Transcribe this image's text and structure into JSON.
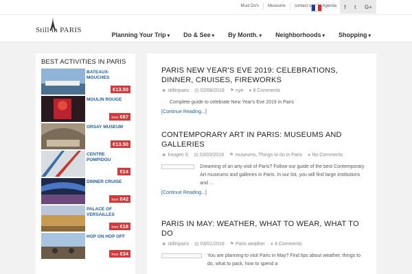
{
  "topbar": {
    "links": [
      "Must Do's",
      "Museums",
      "contact us",
      "Agenda"
    ],
    "social": [
      "f",
      "t",
      "G+"
    ]
  },
  "header": {
    "logo": "Still in PARIS",
    "nav": [
      "Planning Your Trip",
      "Do & See",
      "By Month.",
      "Neighborhoods",
      "Shopping"
    ]
  },
  "sidebar": {
    "title": "BEST ACTIVITIES IN PARIS",
    "activities": [
      {
        "name": "BATEAUX-MOUCHES",
        "price": "€13.50",
        "from": ""
      },
      {
        "name": "MOULIN ROUGE",
        "price": "€87",
        "from": "from"
      },
      {
        "name": "ORSAY MUSEUM",
        "price": "€13.50",
        "from": ""
      },
      {
        "name": "CENTRE POMPIDOU",
        "price": "€14",
        "from": ""
      },
      {
        "name": "DINNER CRUISE",
        "price": "€42",
        "from": "from"
      },
      {
        "name": "PALACE OF VERSAILLES",
        "price": "€18",
        "from": "from"
      },
      {
        "name": "HOP ON HOP OFF",
        "price": "€34",
        "from": "from"
      }
    ]
  },
  "posts": [
    {
      "title": "PARIS NEW YEAR'S EVE 2019: CELEBRATIONS, DINNER, CRUISES, FIREWORKS",
      "author": "stillinparis",
      "date": "02/08/2018",
      "tags": "nye",
      "comments": "8 Comments",
      "excerpt": "Complete guide to celebrate New Year's Eve 2019 in Paris",
      "readmore": "[Continue Reading...]"
    },
    {
      "title": "CONTEMPORARY ART IN PARIS: MUSEUMS AND GALLERIES",
      "author": "Imogen S",
      "date": "03/03/2018",
      "tags": "museums, Things to do in Paris",
      "comments": "No Comments",
      "excerpt": "Dreaming of an arty visit of Paris? Follow our guide of the best Contemporary Art museums and galleries in Paris. In our list, you will find large institutions and ...",
      "readmore": "[Continue Reading...]"
    },
    {
      "title": "PARIS IN MAY: WEATHER, WHAT TO WEAR, WHAT TO DO",
      "author": "stillinparis",
      "date": "03/01/2018",
      "tags": "Paris weather",
      "comments": "4 Comments",
      "excerpt": "You are planning to visit Paris in May? Find tips about weather, things to do, what to pack, how to spend a",
      "readmore": ""
    }
  ],
  "colors": {
    "accent": "#1c5b9c",
    "price": "#d43a3a",
    "flag": [
      "#1f3fa0",
      "#ffffff",
      "#e02a2a"
    ]
  }
}
